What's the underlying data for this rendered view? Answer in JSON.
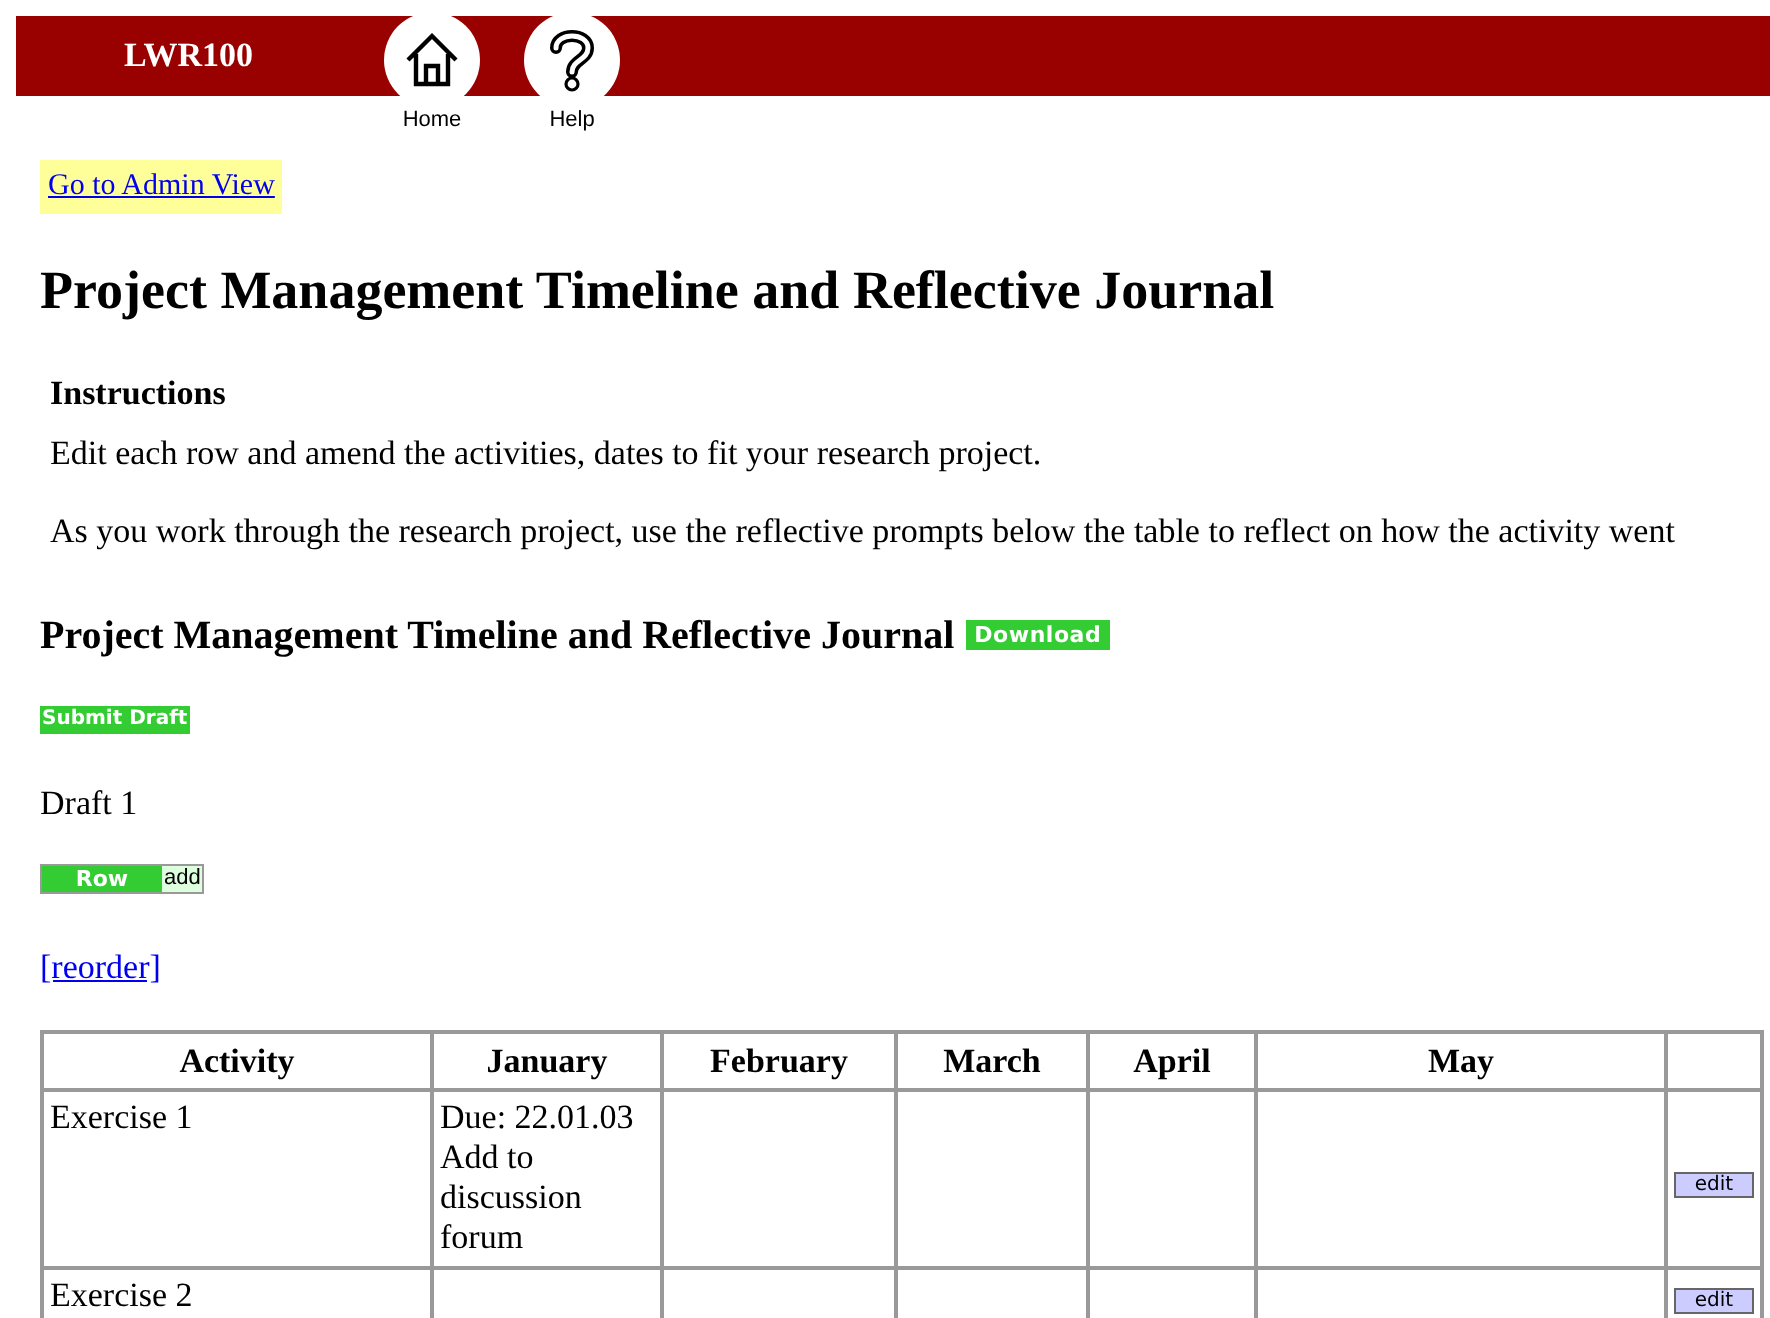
{
  "header": {
    "title": "LWR100",
    "nav": [
      {
        "kind": "home",
        "label": "Home"
      },
      {
        "kind": "help",
        "label": "Help"
      }
    ]
  },
  "admin_link": "Go to Admin View",
  "page_title": "Project Management Timeline and Reflective Journal",
  "instructions": {
    "heading": "Instructions",
    "paragraphs": [
      "Edit each row and amend the activities, dates to fit your research project.",
      "As you work through the research project, use the reflective prompts below the table to reflect on how the activity went"
    ]
  },
  "section": {
    "title": "Project Management Timeline and Reflective Journal",
    "download": "Download",
    "submit": "Submit Draft",
    "draft": "Draft 1",
    "row_button": "Row",
    "row_add": "add",
    "reorder": "[reorder]"
  },
  "table": {
    "columns": [
      "Activity",
      "January",
      "February",
      "March",
      "April",
      "May"
    ],
    "rows": [
      {
        "cells": [
          "Exercise 1",
          "Due: 22.01.03 Add to discussion forum"
        ],
        "action": "edit"
      },
      {
        "cells": [
          "Exercise 2"
        ],
        "action": "edit"
      }
    ]
  }
}
